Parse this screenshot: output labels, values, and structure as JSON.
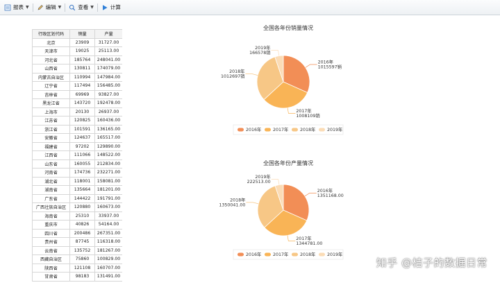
{
  "toolbar": {
    "items": [
      {
        "label": "报表",
        "icon": "report-icon",
        "dropdown": true
      },
      {
        "label": "编辑",
        "icon": "pencil-icon",
        "dropdown": true
      },
      {
        "label": "查看",
        "icon": "magnifier-icon",
        "dropdown": true
      },
      {
        "label": "计算",
        "icon": "play-icon",
        "dropdown": false
      }
    ]
  },
  "table": {
    "headers": [
      "行政区划代码",
      "销量",
      "产量"
    ],
    "rows": [
      [
        "北京",
        "23909",
        "31727.00"
      ],
      [
        "天津市",
        "19025",
        "25113.00"
      ],
      [
        "河北省",
        "185764",
        "248041.00"
      ],
      [
        "山西省",
        "130811",
        "174079.00"
      ],
      [
        "内蒙古自治区",
        "110994",
        "147984.00"
      ],
      [
        "辽宁省",
        "117494",
        "156485.00"
      ],
      [
        "吉林省",
        "69969",
        "93827.00"
      ],
      [
        "黑龙江省",
        "143720",
        "192478.00"
      ],
      [
        "上海市",
        "20130",
        "26937.00"
      ],
      [
        "江苏省",
        "120825",
        "160436.00"
      ],
      [
        "浙江省",
        "101591",
        "136165.00"
      ],
      [
        "安徽省",
        "124637",
        "165517.00"
      ],
      [
        "福建省",
        "97202",
        "129890.00"
      ],
      [
        "江西省",
        "111066",
        "148522.00"
      ],
      [
        "山东省",
        "160055",
        "212834.00"
      ],
      [
        "河南省",
        "174736",
        "232271.00"
      ],
      [
        "湖北省",
        "118001",
        "158081.00"
      ],
      [
        "湖南省",
        "135664",
        "181201.00"
      ],
      [
        "广东省",
        "144422",
        "191791.00"
      ],
      [
        "广西壮族自治区",
        "120880",
        "160673.00"
      ],
      [
        "海南省",
        "25310",
        "33937.00"
      ],
      [
        "重庆市",
        "40826",
        "54164.00"
      ],
      [
        "四川省",
        "200486",
        "267351.00"
      ],
      [
        "贵州省",
        "87745",
        "116318.00"
      ],
      [
        "云南省",
        "135752",
        "181267.00"
      ],
      [
        "西藏自治区",
        "75860",
        "100829.00"
      ],
      [
        "陕西省",
        "121108",
        "160707.00"
      ],
      [
        "甘肃省",
        "98183",
        "131491.00"
      ]
    ]
  },
  "chart_data": [
    {
      "type": "pie",
      "title": "全国各年份销量情况",
      "categories": [
        "2016年",
        "2017年",
        "2018年",
        "2019年"
      ],
      "values": [
        1015597,
        1008109,
        1012697,
        166578
      ],
      "labels": [
        "2016年\n1015597销",
        "2017年\n1008109销",
        "2018年\n1012697销",
        "2019年\n166578销"
      ],
      "legend": "bottom",
      "colors": [
        "#f28e56",
        "#f9b456",
        "#f7c786",
        "#fbdcb6"
      ]
    },
    {
      "type": "pie",
      "title": "全国各年份产量情况",
      "categories": [
        "2016年",
        "2017年",
        "2018年",
        "2019年"
      ],
      "values": [
        1351168,
        1344781,
        1350041,
        222513
      ],
      "labels": [
        "2016年\n1351168.00",
        "2017年\n1344781.00",
        "2018年\n1350041.00",
        "2019年\n222513.00"
      ],
      "legend": "bottom",
      "colors": [
        "#f28e56",
        "#f9b456",
        "#f7c786",
        "#fbdcb6"
      ]
    }
  ],
  "watermark": "知乎 @桔子的数据日常"
}
